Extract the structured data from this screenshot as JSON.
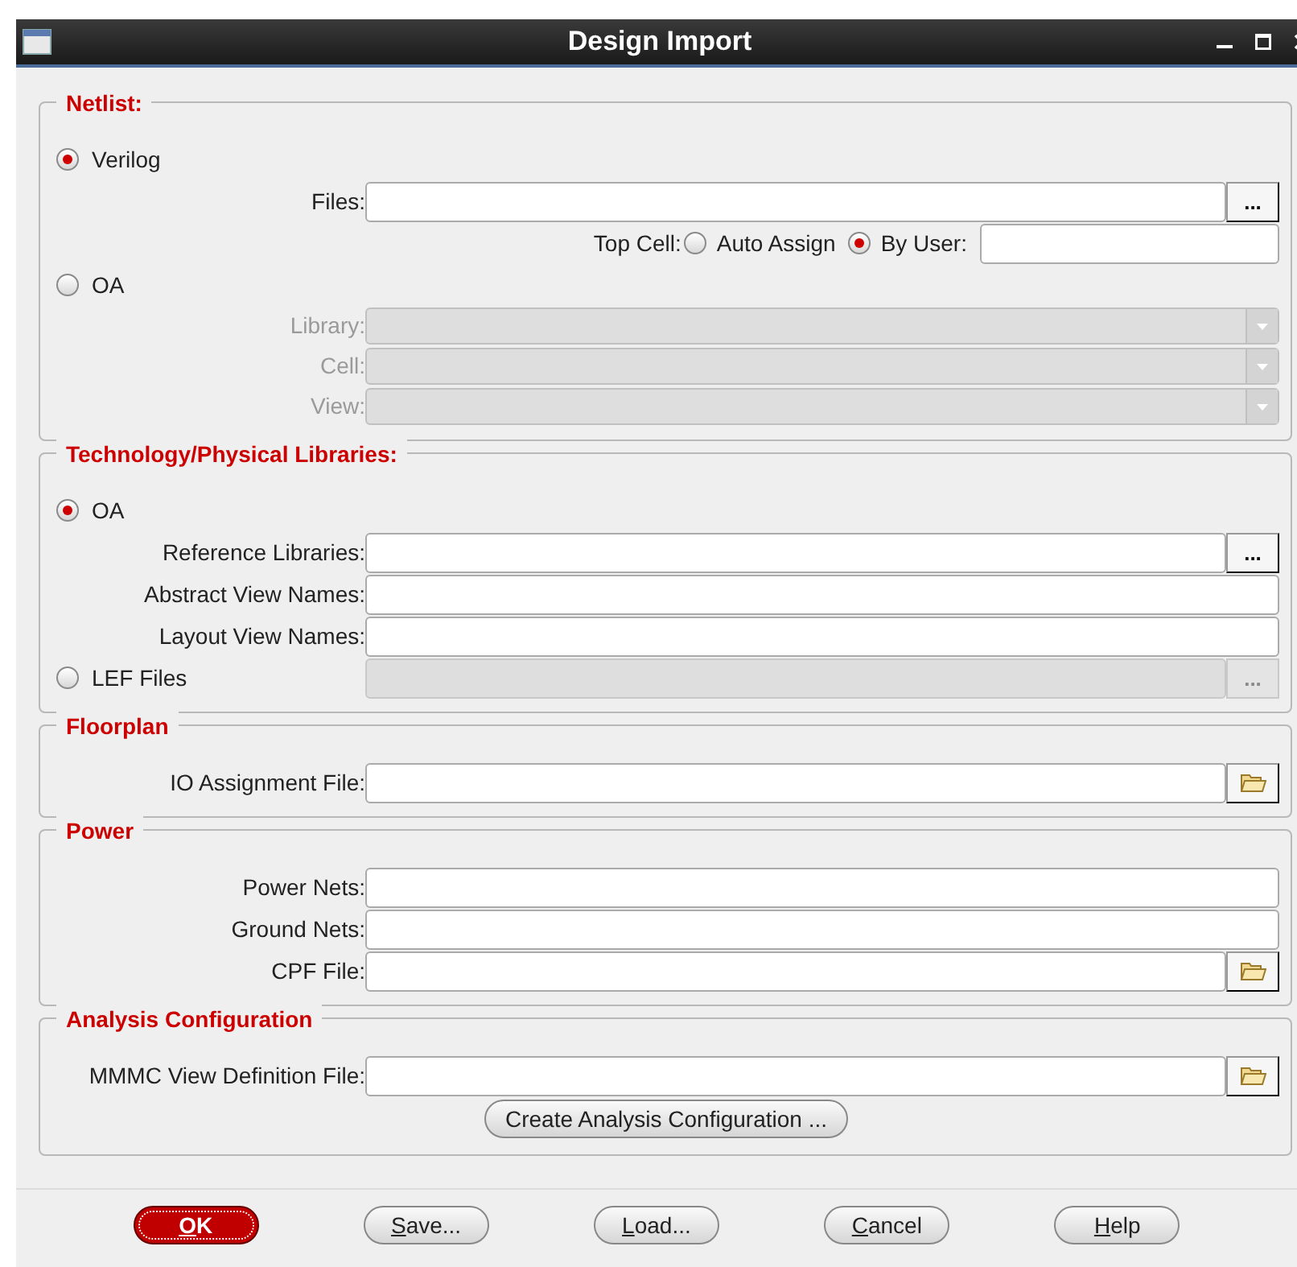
{
  "window": {
    "title": "Design Import"
  },
  "sections": [
    {
      "title": "Netlist:",
      "rows": [
        {
          "kind": "radio",
          "label": "Verilog",
          "selected": true
        },
        {
          "kind": "field",
          "label": "Files:",
          "disabled": false,
          "action": {
            "kind": "ellipsis",
            "text": "...",
            "disabled": false
          }
        },
        {
          "kind": "topcell",
          "label": "Top Cell:",
          "options": [
            {
              "label": "Auto Assign",
              "selected": false
            },
            {
              "label": "By User:",
              "selected": true
            }
          ]
        },
        {
          "kind": "radio",
          "label": "OA",
          "selected": false
        },
        {
          "kind": "combo",
          "label": "Library:",
          "disabled": true
        },
        {
          "kind": "combo",
          "label": "Cell:",
          "disabled": true
        },
        {
          "kind": "combo",
          "label": "View:",
          "disabled": true
        }
      ]
    },
    {
      "title": "Technology/Physical Libraries:",
      "rows": [
        {
          "kind": "radio",
          "label": "OA",
          "selected": true
        },
        {
          "kind": "field",
          "label": "Reference Libraries:",
          "disabled": false,
          "action": {
            "kind": "ellipsis",
            "text": "...",
            "disabled": false
          }
        },
        {
          "kind": "field",
          "label": "Abstract View Names:",
          "disabled": false
        },
        {
          "kind": "field",
          "label": "Layout View Names:",
          "disabled": false
        },
        {
          "kind": "radio_field",
          "label": "LEF Files",
          "selected": false,
          "disabled": true,
          "action": {
            "kind": "ellipsis",
            "text": "...",
            "disabled": true
          }
        }
      ]
    },
    {
      "title": "Floorplan",
      "rows": [
        {
          "kind": "field",
          "label": "IO Assignment File:",
          "disabled": false,
          "action": {
            "kind": "folder"
          }
        }
      ]
    },
    {
      "title": "Power",
      "rows": [
        {
          "kind": "field",
          "label": "Power Nets:",
          "disabled": false
        },
        {
          "kind": "field",
          "label": "Ground Nets:",
          "disabled": false
        },
        {
          "kind": "field",
          "label": "CPF File:",
          "disabled": false,
          "action": {
            "kind": "folder"
          }
        }
      ]
    },
    {
      "title": "Analysis Configuration",
      "rows": [
        {
          "kind": "field",
          "label": "MMMC View Definition File:",
          "disabled": false,
          "action": {
            "kind": "folder"
          }
        },
        {
          "kind": "button",
          "label": "Create Analysis Configuration ..."
        }
      ]
    }
  ],
  "buttons": [
    {
      "access_key": "O",
      "rest": "K",
      "default": true
    },
    {
      "access_key": "S",
      "rest": "ave...",
      "default": false
    },
    {
      "access_key": "L",
      "rest": "oad...",
      "default": false
    },
    {
      "access_key": "C",
      "rest": "ancel",
      "default": false
    },
    {
      "access_key": "H",
      "rest": "elp",
      "default": false
    }
  ]
}
